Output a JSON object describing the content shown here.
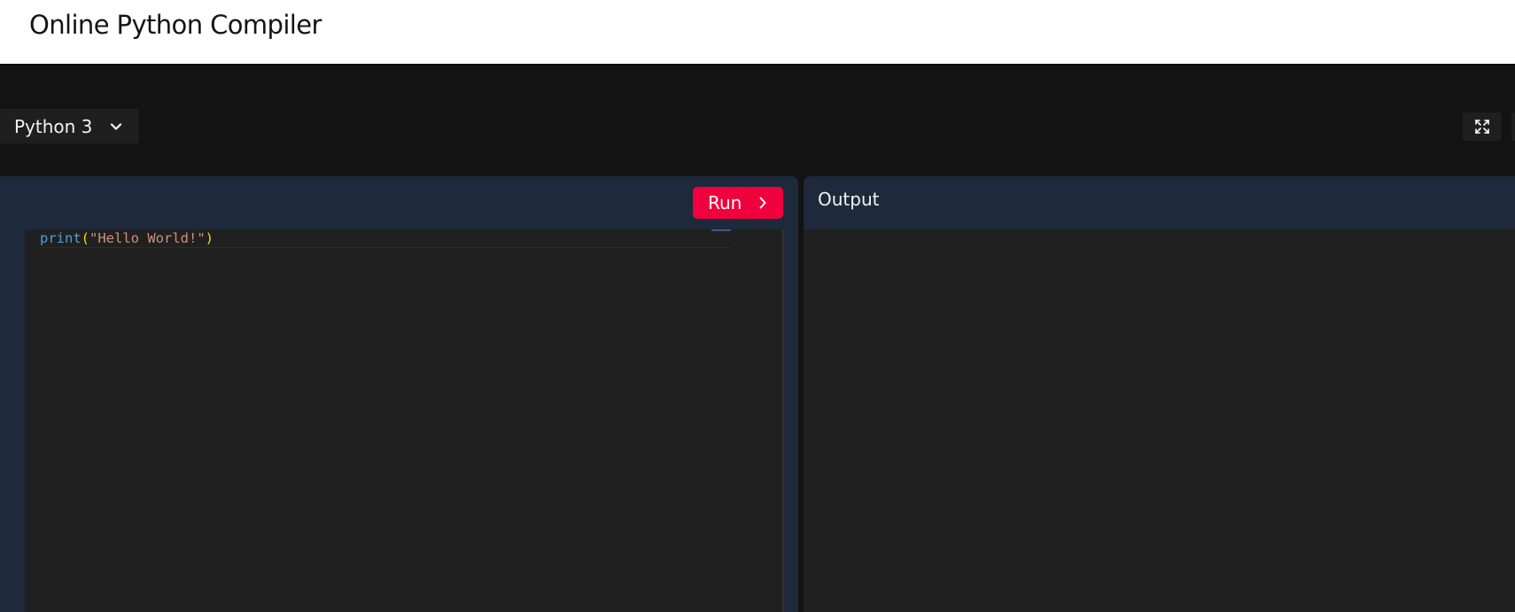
{
  "header": {
    "title": "Online Python Compiler"
  },
  "toolbar": {
    "language_label": "Python 3",
    "language_icon": "chevron-down-icon",
    "fullscreen_icon": "expand-icon"
  },
  "editor": {
    "run_label": "Run",
    "run_icon": "chevron-right-icon",
    "code": {
      "function": "print",
      "open_paren": "(",
      "string": "\"Hello World!\"",
      "close_paren": ")"
    }
  },
  "output": {
    "title": "Output",
    "content": ""
  },
  "colors": {
    "run_button": "#f0003c",
    "panel_header": "#1e293b",
    "editor_background": "#202020",
    "workspace_background": "#131313"
  }
}
